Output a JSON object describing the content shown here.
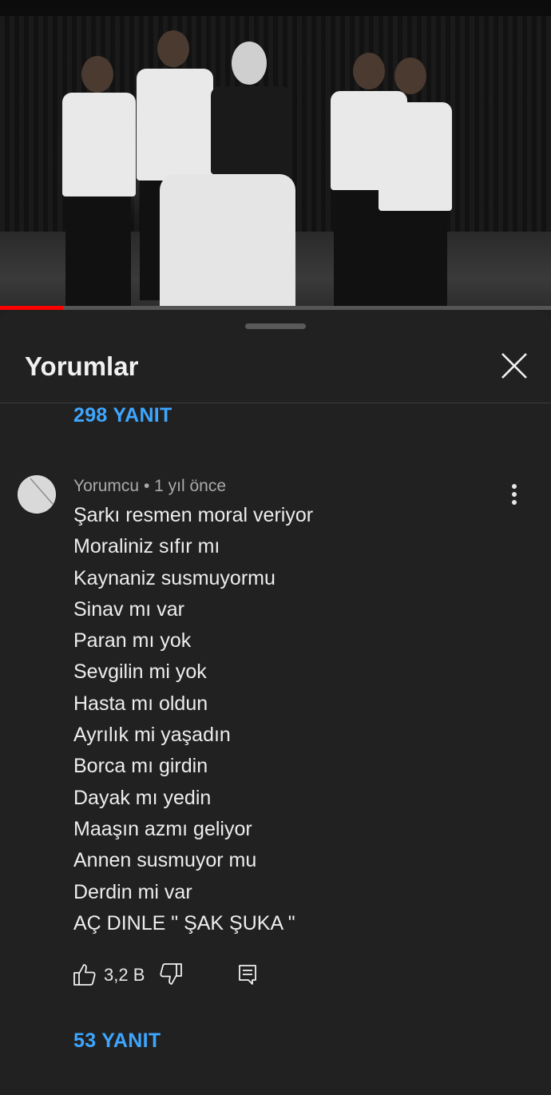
{
  "video": {
    "progress_fraction": 0.115
  },
  "panel": {
    "title": "Yorumlar",
    "close_icon": "close-icon"
  },
  "thread_above": {
    "replies_label": "298 YANIT"
  },
  "comment": {
    "author": "Yorumcu",
    "separator": " • ",
    "time": "1 yıl önce",
    "avatar_icon": "default-avatar-icon",
    "lines": [
      "Şarkı resmen moral veriyor",
      "Moraliniz sıfır mı",
      "Kaynaniz susmuyormu",
      "Sinav mı var",
      "Paran mı yok",
      "Sevgilin mi yok",
      "Hasta mı oldun",
      "Ayrılık mi yaşadın",
      "Borca mı girdin",
      "Dayak mı yedin",
      "Maaşın azmı geliyor",
      "Annen susmuyor mu",
      "Derdin mi var",
      "AÇ DINLE \" ŞAK ŞUKA \""
    ],
    "like_count": "3,2 B",
    "like_icon": "thumbs-up-icon",
    "dislike_icon": "thumbs-down-icon",
    "reply_icon": "reply-comment-icon",
    "replies_label": "53 YANIT"
  },
  "colors": {
    "background": "#212121",
    "accent_link": "#3ea6ff",
    "progress": "#ff0000"
  }
}
